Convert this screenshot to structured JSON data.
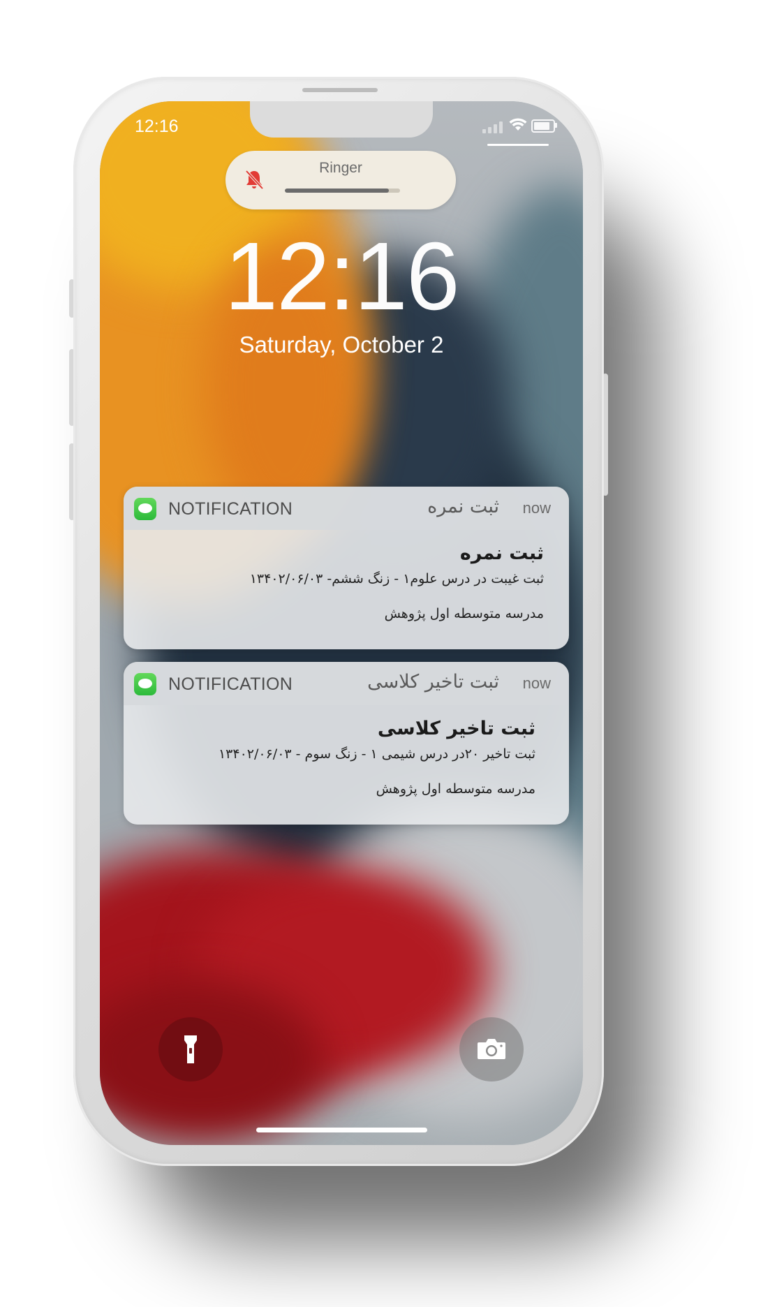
{
  "status_bar": {
    "time": "12:16",
    "signal_icon": "cellular-signal-icon",
    "wifi_icon": "wifi-icon",
    "battery_icon": "battery-icon"
  },
  "ringer": {
    "label": "Ringer",
    "icon": "bell-muted-icon",
    "icon_color": "#e23b35",
    "volume_level": 0.9
  },
  "lock_screen": {
    "time": "12:16",
    "date": "Saturday, October 2"
  },
  "notifications": [
    {
      "app_name": "NOTIFICATION",
      "app_icon": "messages-icon",
      "header_title": "ثبت نمره",
      "time": "now",
      "title": "ثبت نمره",
      "text": "ثبت غیبت در درس علوم۱ - زنگ ششم- ۱۳۴۰۲/۰۶/۰۳",
      "school": "مدرسه متوسطه اول پژوهش"
    },
    {
      "app_name": "NOTIFICATION",
      "app_icon": "messages-icon",
      "header_title": "ثبت تاخیر کلاسی",
      "time": "now",
      "title": "ثبت تاخیر کلاسی",
      "text": "ثبت تاخیر ۲۰در درس شیمی ۱ - زنگ سوم - ۱۳۴۰۲/۰۶/۰۳",
      "school": "مدرسه متوسطه اول پژوهش"
    }
  ],
  "quick_actions": {
    "left": "flashlight-icon",
    "right": "camera-icon"
  },
  "colors": {
    "messages_green": "#34c759",
    "accent_orange": "#e89222",
    "accent_red": "#a4141c",
    "accent_navy": "#21303f"
  }
}
